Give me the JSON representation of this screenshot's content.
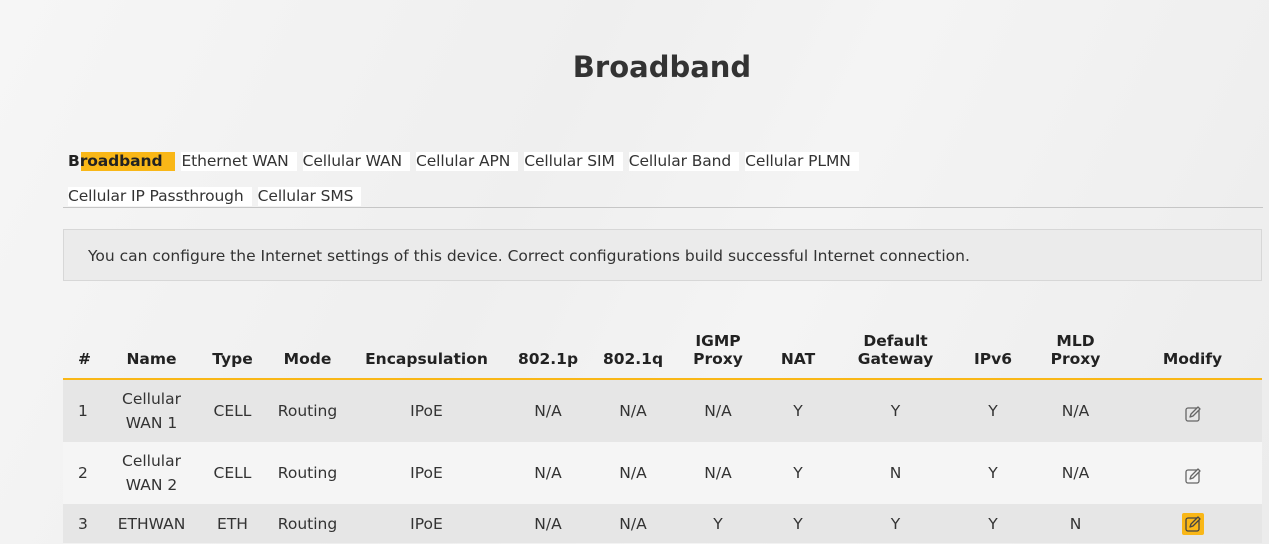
{
  "page": {
    "title": "Broadband"
  },
  "tabs": {
    "row1": [
      {
        "label": "Broadband",
        "active": true
      },
      {
        "label": "Ethernet WAN"
      },
      {
        "label": "Cellular WAN"
      },
      {
        "label": "Cellular APN"
      },
      {
        "label": "Cellular SIM"
      },
      {
        "label": "Cellular Band"
      },
      {
        "label": "Cellular PLMN"
      }
    ],
    "row2": [
      {
        "label": "Cellular IP Passthrough"
      },
      {
        "label": "Cellular SMS"
      }
    ]
  },
  "info": {
    "text": "You can configure the Internet settings of this device. Correct configurations build successful Internet connection."
  },
  "table": {
    "headers": {
      "num": "#",
      "name": "Name",
      "type": "Type",
      "mode": "Mode",
      "encapsulation": "Encapsulation",
      "p8021p": "802.1p",
      "p8021q": "802.1q",
      "igmp_1": "IGMP",
      "igmp_2": "Proxy",
      "nat": "NAT",
      "gateway_1": "Default",
      "gateway_2": "Gateway",
      "ipv6": "IPv6",
      "mld_1": "MLD",
      "mld_2": "Proxy",
      "modify": "Modify"
    },
    "rows": [
      {
        "num": "1",
        "name_1": "Cellular",
        "name_2": "WAN 1",
        "type": "CELL",
        "mode": "Routing",
        "encapsulation": "IPoE",
        "p8021p": "N/A",
        "p8021q": "N/A",
        "igmp": "N/A",
        "nat": "Y",
        "gateway": "Y",
        "ipv6": "Y",
        "mld": "N/A",
        "modify_icon": "edit-icon"
      },
      {
        "num": "2",
        "name_1": "Cellular",
        "name_2": "WAN 2",
        "type": "CELL",
        "mode": "Routing",
        "encapsulation": "IPoE",
        "p8021p": "N/A",
        "p8021q": "N/A",
        "igmp": "N/A",
        "nat": "Y",
        "gateway": "N",
        "ipv6": "Y",
        "mld": "N/A",
        "modify_icon": "edit-icon"
      },
      {
        "num": "3",
        "name": "ETHWAN",
        "type": "ETH",
        "mode": "Routing",
        "encapsulation": "IPoE",
        "p8021p": "N/A",
        "p8021q": "N/A",
        "igmp": "Y",
        "nat": "Y",
        "gateway": "Y",
        "ipv6": "Y",
        "mld": "N",
        "modify_icon": "edit-icon",
        "modify_highlight": "#f9b717"
      }
    ]
  },
  "colors": {
    "accent": "#f9b717",
    "text": "#333333",
    "row_dark": "#e6e6e6",
    "row_light": "#f5f5f5"
  }
}
